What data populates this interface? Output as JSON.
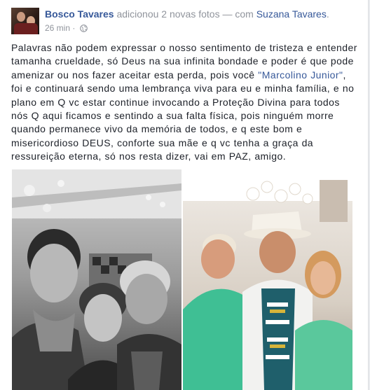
{
  "post": {
    "author": "Bosco Tavares",
    "action": "adicionou 2 novas fotos",
    "with_sep": "— com",
    "tagged": "Suzana Tavares",
    "tagged_suffix": ".",
    "time": "26 min",
    "dot": "·",
    "privacy_icon": "globe-icon",
    "text_before": "Palavras não podem expressar o nosso sentimento de tristeza e entender tamanha crueldade, só Deus na sua infinita bondade e poder é que pode amenizar ou nos fazer aceitar esta perda, pois você ",
    "quoted_name": "\"Marcolino Junior\"",
    "text_after": ", foi e continuará sendo uma lembrança viva para eu e minha família, e no plano em Q vc estar continue invocando a Proteção Divina para todos nós Q aqui ficamos e sentindo a sua falta física, pois ninguém morre quando permanece vivo da memória de todos, e q este bom e misericordioso DEUS, conforte sua mãe e q vc tenha a graça da ressureição eterna, só nos resta dizer, vai em PAZ, amigo."
  },
  "colors": {
    "link": "#365899",
    "text": "#1d2129",
    "meta": "#90949c"
  }
}
